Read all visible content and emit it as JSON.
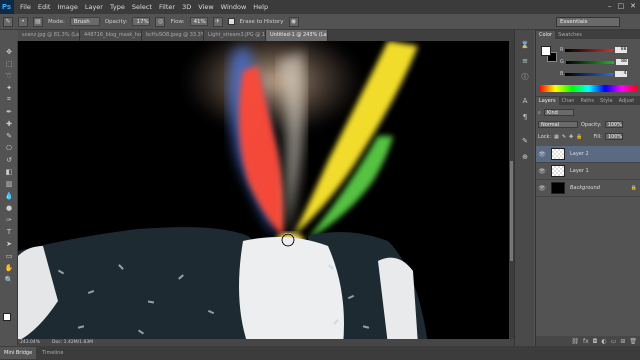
{
  "app": {
    "logo": "Ps"
  },
  "menu": [
    "File",
    "Edit",
    "Image",
    "Layer",
    "Type",
    "Select",
    "Filter",
    "3D",
    "View",
    "Window",
    "Help"
  ],
  "options": {
    "mode_label": "Mode:",
    "mode_value": "Brush",
    "opacity_label": "Opacity:",
    "opacity_value": "17%",
    "flow_label": "Flow:",
    "flow_value": "41%",
    "erase_history_label": "Erase to History",
    "workspace": "Essentials"
  },
  "doc_tabs": [
    {
      "label": "scenz.jpg @ 81.3% (Layer 1, R...",
      "active": false
    },
    {
      "label": "448716_blog_mask_horizontal.jpg",
      "active": false
    },
    {
      "label": "bcHuSO8.jpeg @ 33.3% (BGB/...",
      "active": false
    },
    {
      "label": "Light_stream3.JPG @ 16.7% (L...",
      "active": false
    },
    {
      "label": "Untitled-1 @ 243% (Layer 2, RGB/8) *",
      "active": true
    }
  ],
  "status": {
    "zoom": "243.04%",
    "doc": "Doc: 1.42M/1.83M"
  },
  "bottom_tabs": [
    "Mini Bridge",
    "Timeline"
  ],
  "color_panel": {
    "tabs": [
      "Color",
      "Swatches"
    ],
    "sliders": [
      {
        "name": "R",
        "value": "88",
        "color": "#d23030"
      },
      {
        "name": "G",
        "value": "88",
        "color": "#27b327"
      },
      {
        "name": "B",
        "value": "4",
        "color": "#2c6de0"
      }
    ]
  },
  "layers_panel": {
    "tabs": [
      "Layers",
      "Chan",
      "Paths",
      "Style",
      "Adjust"
    ],
    "kind": "Kind",
    "blend": "Normal",
    "opacity_label": "Opacity:",
    "opacity": "100%",
    "lock_label": "Lock:",
    "fill_label": "Fill:",
    "fill": "100%",
    "layers": [
      {
        "name": "Layer 2",
        "thumb": "checker",
        "selected": true,
        "italic": false
      },
      {
        "name": "Layer 1",
        "thumb": "checker",
        "selected": false,
        "italic": false
      },
      {
        "name": "Background",
        "thumb": "black",
        "selected": false,
        "italic": true
      }
    ]
  }
}
